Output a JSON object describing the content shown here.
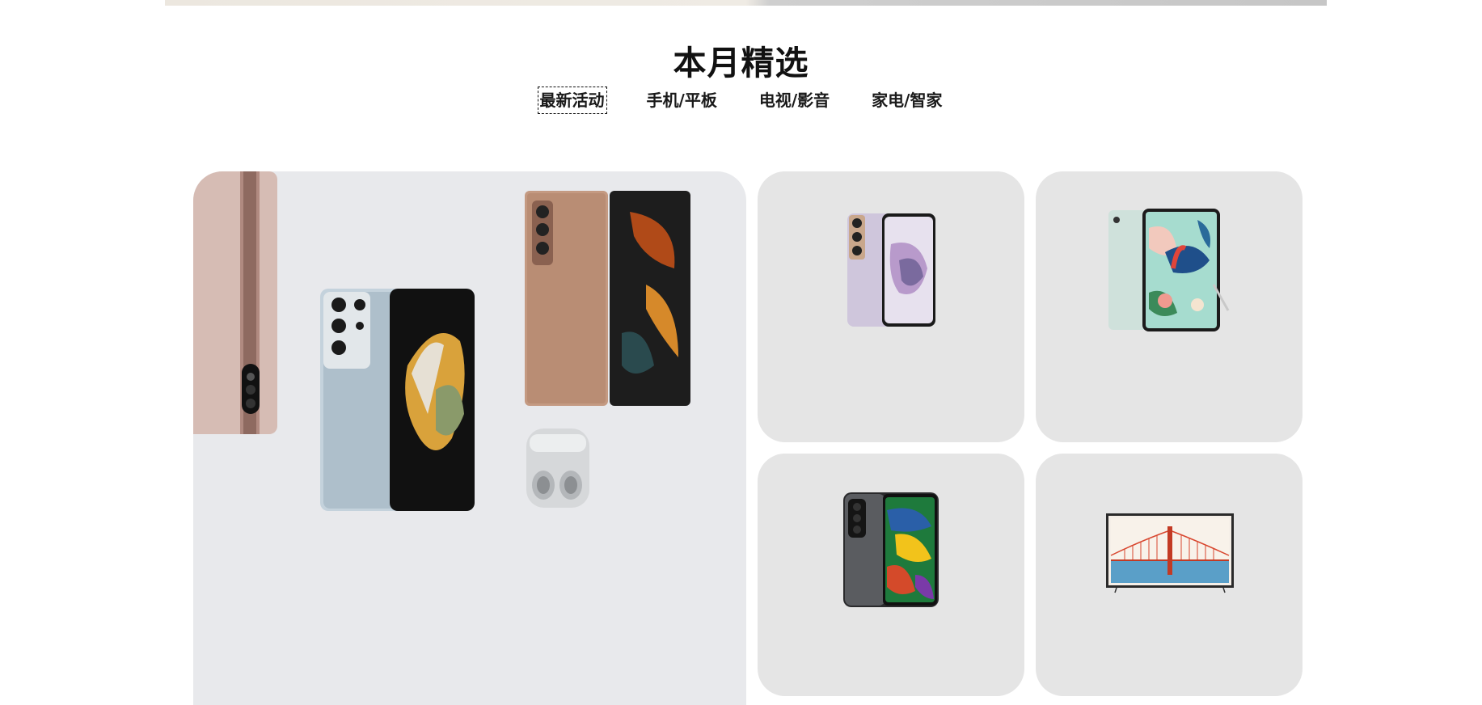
{
  "section": {
    "title": "本月精选"
  },
  "tabs": [
    {
      "label": "最新活动",
      "active": true
    },
    {
      "label": "手机/平板",
      "active": false
    },
    {
      "label": "电视/影音",
      "active": false
    },
    {
      "label": "家电/智家",
      "active": false
    }
  ],
  "products": {
    "main_card": [
      "galaxy-tab-pink",
      "galaxy-s21-ultra-silver",
      "galaxy-z-fold2-bronze",
      "galaxy-buds-pro-silver"
    ],
    "card_1": "galaxy-s21-violet",
    "card_2": "galaxy-tab-s7-fe",
    "card_3": "galaxy-f52-black",
    "card_4": "the-frame-tv"
  },
  "colors": {
    "main_card_bg": "#e8e9ec",
    "small_card_bg": "#e5e5e5",
    "text": "#111111"
  }
}
